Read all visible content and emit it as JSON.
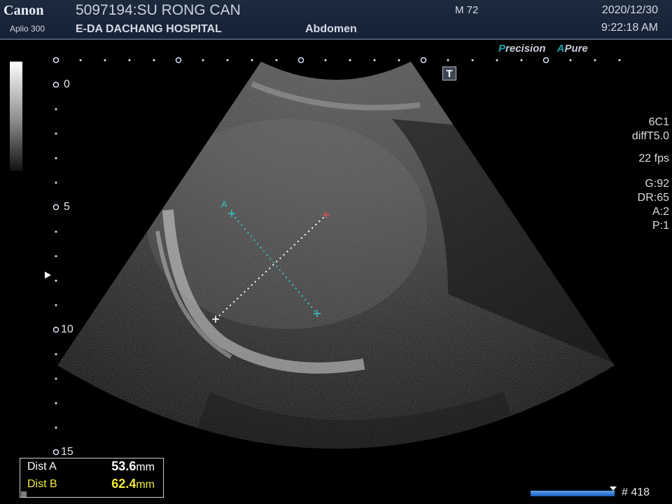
{
  "header": {
    "brand": "Canon",
    "model": "Aplio 300",
    "patient": "5097194:SU RONG CAN",
    "hospital": "E-DA DACHANG HOSPITAL",
    "exam": "Abdomen",
    "mi": "M 72",
    "date": "2020/12/30",
    "time": "9:22:18 AM"
  },
  "modes": {
    "precision": "Precision",
    "apure_a": "A",
    "apure_text": "Pure"
  },
  "depth_scale": {
    "labels": [
      "0",
      "5",
      "10",
      "15"
    ],
    "unit": "cm"
  },
  "params": {
    "probe": "6C1",
    "preset": "diffT5.0",
    "fps": "22 fps",
    "gain": "G:92",
    "dr": "DR:65",
    "a": "A:2",
    "p": "P:1"
  },
  "measurements": {
    "marker_label": "A",
    "dist_a_label": "Dist A",
    "dist_a_value": "53.6",
    "dist_b_label": "Dist B",
    "dist_b_value": "62.4",
    "unit": "mm"
  },
  "cine": {
    "frame": "# 418"
  },
  "icons": {
    "t_icon": "T"
  },
  "colors": {
    "header_bg": "#1d2a3e",
    "accent_teal": "#1aa8a8",
    "dist_b_yellow": "#f2ea3a",
    "cine_blue": "#1a5bbd"
  }
}
